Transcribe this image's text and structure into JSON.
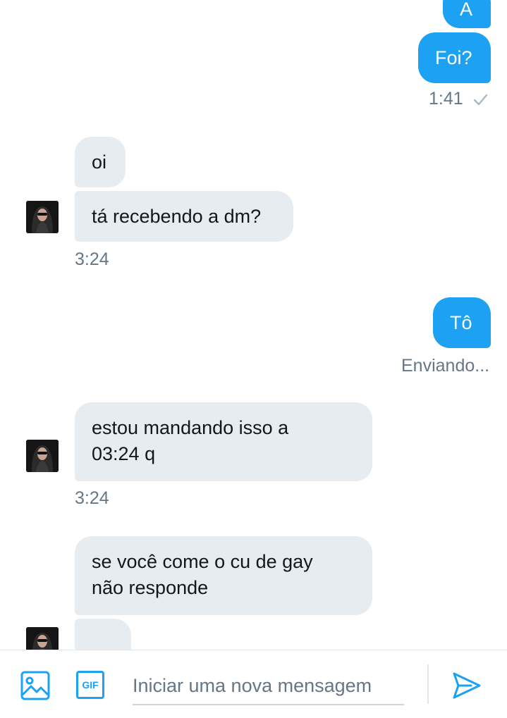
{
  "messages": {
    "m0": {
      "text": "A"
    },
    "m1": {
      "text": "Foi?"
    },
    "m1_time": "1:41",
    "m2": {
      "text": "oi"
    },
    "m3": {
      "text": "tá recebendo a dm?"
    },
    "m3_time": "3:24",
    "m4": {
      "text": "Tô"
    },
    "m4_status": "Enviando...",
    "m5": {
      "line1": "estou mandando isso a",
      "line2": "03:24 q"
    },
    "m5_time": "3:24",
    "m6": {
      "line1": "se você come o cu de gay",
      "line2": "não responde"
    },
    "m7": {
      "text": ""
    }
  },
  "composer": {
    "placeholder": "Iniciar uma nova mensagem",
    "gif_label": "GIF"
  },
  "icons": {
    "image": "image-icon",
    "gif": "gif-icon",
    "send": "send-icon",
    "read_check": "check-icon"
  },
  "colors": {
    "accent": "#1da1f2",
    "incoming_bubble": "#e6ecf0",
    "meta_text": "#657786"
  }
}
